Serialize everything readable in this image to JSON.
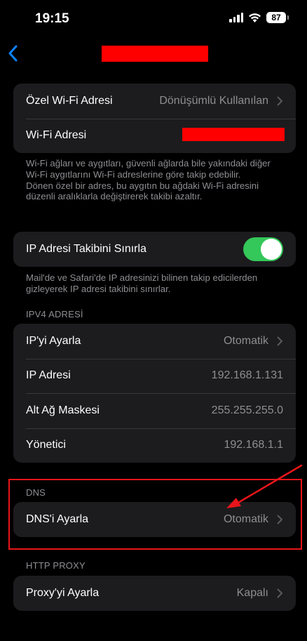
{
  "status_bar": {
    "time": "19:15",
    "battery": "87"
  },
  "nav": {
    "back_icon": "chevron-left-icon",
    "accent_color": "#0a84ff",
    "title_redacted": true
  },
  "wifi": {
    "private_address_label": "Özel Wi-Fi Adresi",
    "private_address_value": "Dönüşümlü Kullanılan",
    "wifi_address_label": "Wi-Fi Adresi",
    "note": "Wi-Fi ağları ve aygıtları, güvenli ağlarda bile yakındaki diğer Wi-Fi aygıtlarını Wi-Fi adreslerine göre takip edebilir.\nDönen özel bir adres, bu aygıtın bu ağdaki Wi-Fi adresini düzenli aralıklarla değiştirerek takibi azaltır."
  },
  "ip_tracking": {
    "label": "IP Adresi Takibini Sınırla",
    "enabled": true,
    "toggle_color": "#34c759",
    "note": "Mail'de ve Safari'de IP adresinizi bilinen takip edicilerden gizleyerek IP adresi takibini sınırlar."
  },
  "ipv4": {
    "header": "IPV4 ADRESİ",
    "rows": [
      {
        "label": "IP'yi Ayarla",
        "value": "Otomatik",
        "chevron": true
      },
      {
        "label": "IP Adresi",
        "value": "192.168.1.131",
        "chevron": false
      },
      {
        "label": "Alt Ağ Maskesi",
        "value": "255.255.255.0",
        "chevron": false
      },
      {
        "label": "Yönetici",
        "value": "192.168.1.1",
        "chevron": false
      }
    ]
  },
  "dns": {
    "header": "DNS",
    "label": "DNS'i Ayarla",
    "value": "Otomatik"
  },
  "http_proxy": {
    "header": "HTTP PROXY",
    "label": "Proxy'yi Ayarla",
    "value": "Kapalı"
  },
  "annotation": {
    "color": "#e8151a"
  }
}
